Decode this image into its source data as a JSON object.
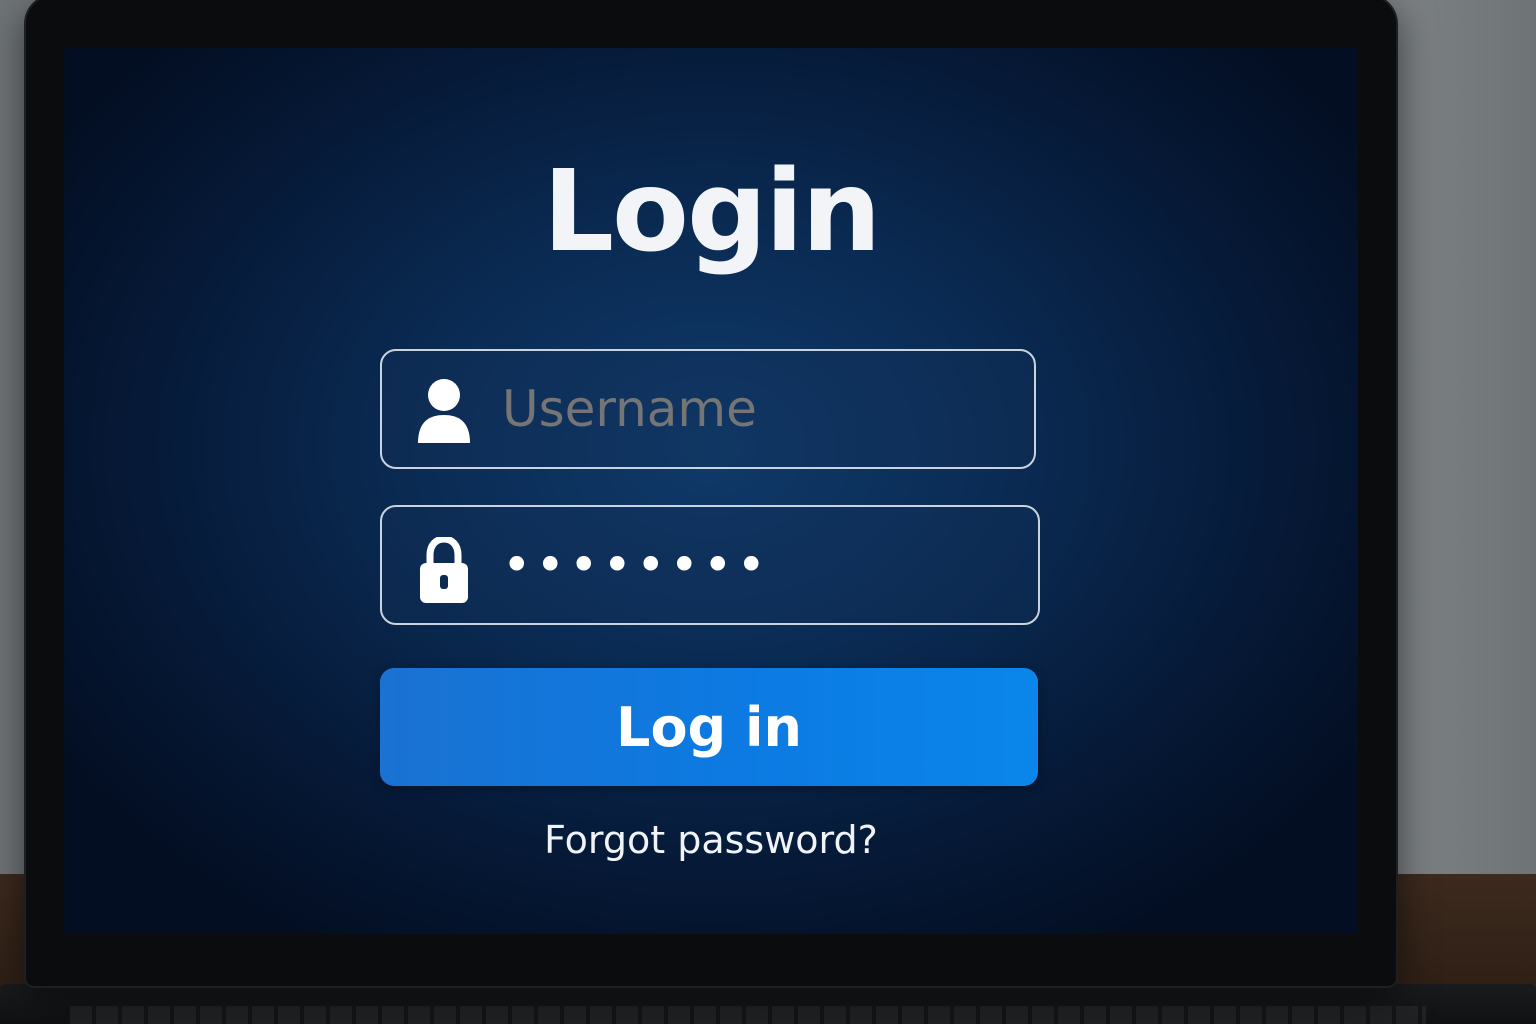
{
  "screen": {
    "title": "Login"
  },
  "form": {
    "username": {
      "placeholder": "Username",
      "icon": "user-icon"
    },
    "password": {
      "masked_value": "••••••••",
      "icon": "lock-icon"
    },
    "submit_label": "Log in",
    "forgot_link": "Forgot password?"
  },
  "colors": {
    "background": "#0a2a52",
    "button": "#0c7ae2",
    "text": "#ffffff",
    "field_border": "#c9d3df"
  }
}
